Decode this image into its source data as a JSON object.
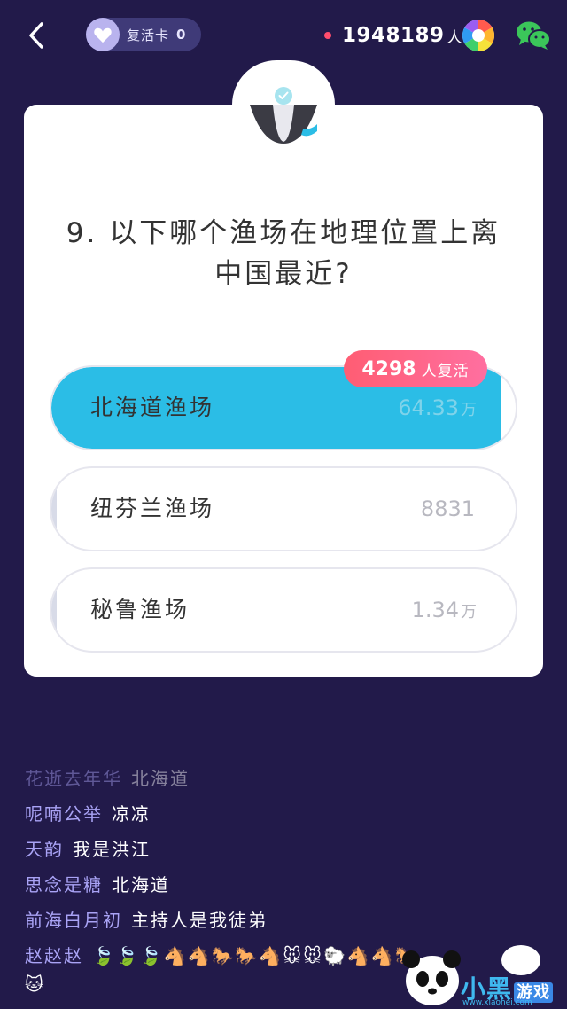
{
  "header": {
    "revive_card_label": "复活卡",
    "revive_card_count": "0",
    "online_count": "1948189",
    "online_unit": "人"
  },
  "question": {
    "text": "9. 以下哪个渔场在地理位置上离中国最近?"
  },
  "options": [
    {
      "label": "北海道渔场",
      "votes": "64.33",
      "unit": "万",
      "selected": true,
      "fill_fraction": 0.97
    },
    {
      "label": "纽芬兰渔场",
      "votes": "8831",
      "unit": ""
    },
    {
      "label": "秘鲁渔场",
      "votes": "1.34",
      "unit": "万"
    }
  ],
  "revive_badge": {
    "count": "4298",
    "text": "人复活"
  },
  "chat": [
    {
      "user": "花逝去年华",
      "message": "北海道",
      "faded": true
    },
    {
      "user": "呢喃公举",
      "message": "凉凉"
    },
    {
      "user": "天韵",
      "message": "我是洪江"
    },
    {
      "user": "思念是糖",
      "message": "北海道"
    },
    {
      "user": "前海白月初",
      "message": "主持人是我徒弟"
    },
    {
      "user": "赵赵赵",
      "message": "🍃🍃🍃🐴🐴🐎🐎🐴🐭🐭🐑🐴🐴🐎"
    }
  ],
  "corner_emoji": "🐱",
  "watermark": {
    "text": "小黑",
    "game": "游戏",
    "url": "www.xiaohei.com"
  },
  "colors": {
    "background": "#221a4a",
    "accent": "#2bbde6",
    "badge": "#ff5d73"
  }
}
